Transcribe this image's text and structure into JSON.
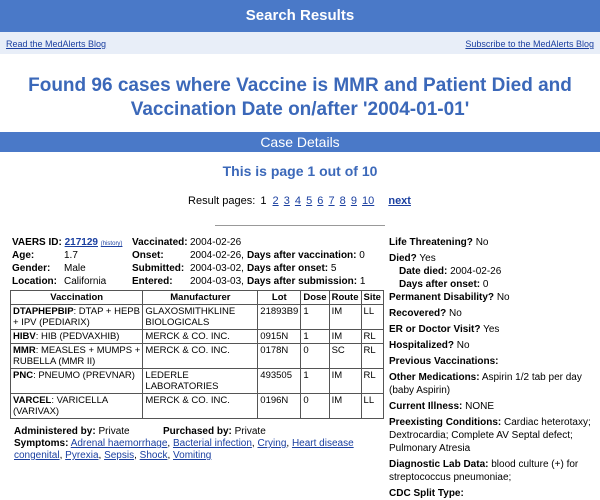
{
  "header": {
    "title": "Search Results"
  },
  "links": {
    "left": "Read the MedAlerts Blog",
    "right": "Subscribe to the MedAlerts Blog"
  },
  "headline": {
    "line1": "Found 96 cases where Vaccine is MMR and Patient Died and",
    "line2": "Vaccination Date on/after '2004-01-01'"
  },
  "case_bar": "Case Details",
  "page_info": "This is page 1 out of 10",
  "pager": {
    "label": "Result pages:",
    "current": "1",
    "pages": [
      "2",
      "3",
      "4",
      "5",
      "6",
      "7",
      "8",
      "9",
      "10"
    ],
    "next": "next"
  },
  "case": {
    "vaers_label": "VAERS ID:",
    "vaers_id": "217129",
    "history": "(history)",
    "age_label": "Age:",
    "age": "1.7",
    "gender_label": "Gender:",
    "gender": "Male",
    "location_label": "Location:",
    "location": "California",
    "vaccinated_label": "Vaccinated:",
    "vaccinated": "2004-02-26",
    "onset_label": "Onset:",
    "onset": "2004-02-26,",
    "days_vacc_label": "Days after vaccination:",
    "days_vacc": "0",
    "submitted_label": "Submitted:",
    "submitted": "2004-03-02,",
    "days_onset_label": "Days after onset:",
    "days_onset": "5",
    "entered_label": "Entered:",
    "entered": "2004-03-03,",
    "days_sub_label": "Days after submission:",
    "days_sub": "1"
  },
  "vaccine_table": {
    "headers": [
      "Vaccination",
      "Manufacturer",
      "Lot",
      "Dose",
      "Route",
      "Site"
    ],
    "rows": [
      {
        "code": "DTAPHEPBIP",
        "desc": ": DTAP + HEPB + IPV (PEDIARIX)",
        "manufacturer": "GLAXOSMITHKLINE BIOLOGICALS",
        "lot": "21893B9",
        "dose": "1",
        "route": "IM",
        "site": "LL"
      },
      {
        "code": "HIBV",
        "desc": ": HIB (PEDVAXHIB)",
        "manufacturer": "MERCK & CO. INC.",
        "lot": "0915N",
        "dose": "1",
        "route": "IM",
        "site": "RL"
      },
      {
        "code": "MMR",
        "desc": ": MEASLES + MUMPS + RUBELLA (MMR II)",
        "manufacturer": "MERCK & CO. INC.",
        "lot": "0178N",
        "dose": "0",
        "route": "SC",
        "site": "RL"
      },
      {
        "code": "PNC",
        "desc": ": PNEUMO (PREVNAR)",
        "manufacturer": "LEDERLE LABORATORIES",
        "lot": "493505",
        "dose": "1",
        "route": "IM",
        "site": "RL"
      },
      {
        "code": "VARCEL",
        "desc": ": VARICELLA (VARIVAX)",
        "manufacturer": "MERCK & CO. INC.",
        "lot": "0196N",
        "dose": "0",
        "route": "IM",
        "site": "LL"
      }
    ]
  },
  "admin": {
    "by_label": "Administered by:",
    "by": "Private",
    "purchased_label": "Purchased by:",
    "purchased": "Private"
  },
  "symptoms": {
    "label": "Symptoms:",
    "items": [
      "Adrenal haemorrhage",
      "Bacterial infection",
      "Crying",
      "Heart disease congenital",
      "Pyrexia",
      "Sepsis",
      "Shock",
      "Vomiting"
    ]
  },
  "right": {
    "life_label": "Life Threatening?",
    "life": "No",
    "died_label": "Died?",
    "died": "Yes",
    "date_died_label": "Date died:",
    "date_died": "2004-02-26",
    "days_after_onset_label": "Days after onset:",
    "days_after_onset": "0",
    "perm_label": "Permanent Disability?",
    "perm": "No",
    "recovered_label": "Recovered?",
    "recovered": "No",
    "er_label": "ER or Doctor Visit?",
    "er": "Yes",
    "hosp_label": "Hospitalized?",
    "hosp": "No",
    "prev_label": "Previous Vaccinations:",
    "meds_label": "Other Medications:",
    "meds": "Aspirin 1/2 tab per day (baby Aspirin)",
    "illness_label": "Current Illness:",
    "illness": "NONE",
    "preexist_label": "Preexisting Conditions:",
    "preexist": "Cardiac heterotaxy; Dextrocardia; Complete AV Septal defect; Pulmonary Atresia",
    "lab_label": "Diagnostic Lab Data:",
    "lab": "blood culture (+) for streptococcus pneumoniae;",
    "cdc_label": "CDC Split Type:"
  }
}
